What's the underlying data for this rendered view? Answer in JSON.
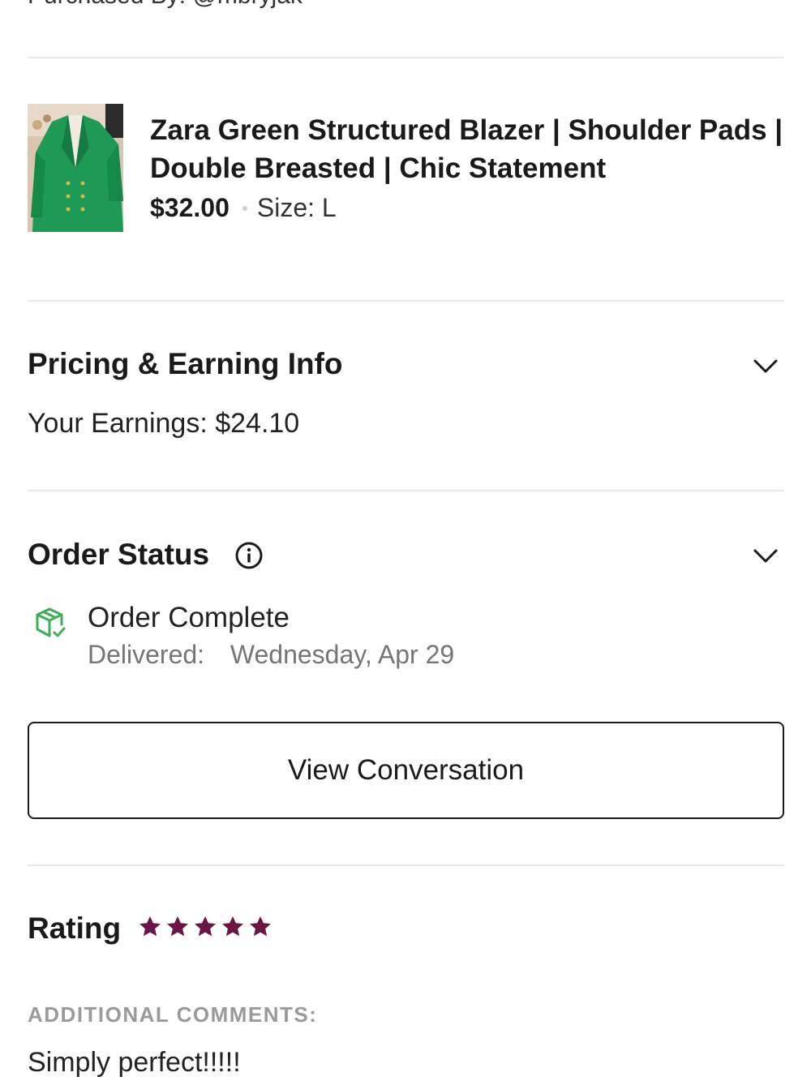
{
  "order": {
    "purchased_by": "Purchased By: @mbryjak"
  },
  "item": {
    "title": "Zara Green Structured Blazer | Shoulder Pads | Double Breasted | Chic Statement",
    "price": "$32.00",
    "size": "Size: L"
  },
  "pricing": {
    "title": "Pricing & Earning Info",
    "earnings": "Your Earnings: $24.10"
  },
  "status": {
    "title": "Order Status",
    "state": "Order Complete",
    "delivered_label": "Delivered:",
    "delivered_date": "Wednesday, Apr 29"
  },
  "actions": {
    "view_conversation": "View Conversation"
  },
  "rating": {
    "title": "Rating",
    "stars": 5,
    "max_stars": 5,
    "comments_label": "ADDITIONAL COMMENTS:",
    "comment": "Simply perfect!!!!!"
  },
  "colors": {
    "star": "#6b1547",
    "status_icon": "#3fae5a",
    "text": "#1f1f1f",
    "muted": "#757575"
  }
}
